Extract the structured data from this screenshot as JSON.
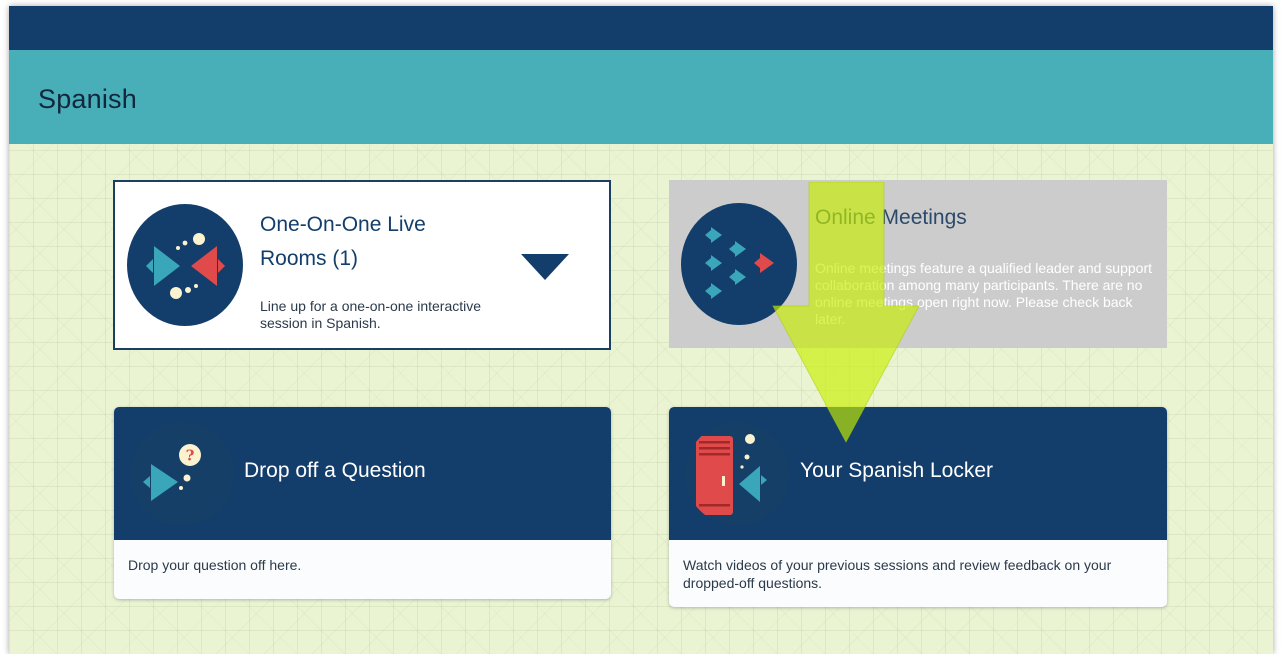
{
  "page": {
    "title": "Spanish"
  },
  "cards": {
    "live": {
      "title": "One-On-One Live Rooms (1)",
      "description": "Line up for a one-on-one interactive session in Spanish.",
      "icon": "fish-facing-icon",
      "expand_icon": "triangle-down-icon"
    },
    "meetings": {
      "title": "Online Meetings",
      "description": "Online meetings feature a qualified leader and support collaboration among many participants. There are no online meetings open right now. Please check back later.",
      "icon": "fish-school-icon"
    },
    "question": {
      "title": "Drop off a Question",
      "description": "Drop your question off here.",
      "icon": "fish-question-icon",
      "badge": "?"
    },
    "locker": {
      "title": "Your Spanish Locker",
      "description": "Watch videos of your previous sessions and review feedback on your dropped-off questions.",
      "icon": "locker-fish-icon"
    }
  },
  "overlay": {
    "icon": "arrow-down-highlight-icon"
  },
  "colors": {
    "navy": "#133e6b",
    "teal": "#48aeb8",
    "background": "#eaf4d3",
    "fish_teal": "#3aa6b9",
    "fish_red": "#e04a4a",
    "arrow_highlight": "#c8f000",
    "disabled_gray": "#cccccc"
  }
}
